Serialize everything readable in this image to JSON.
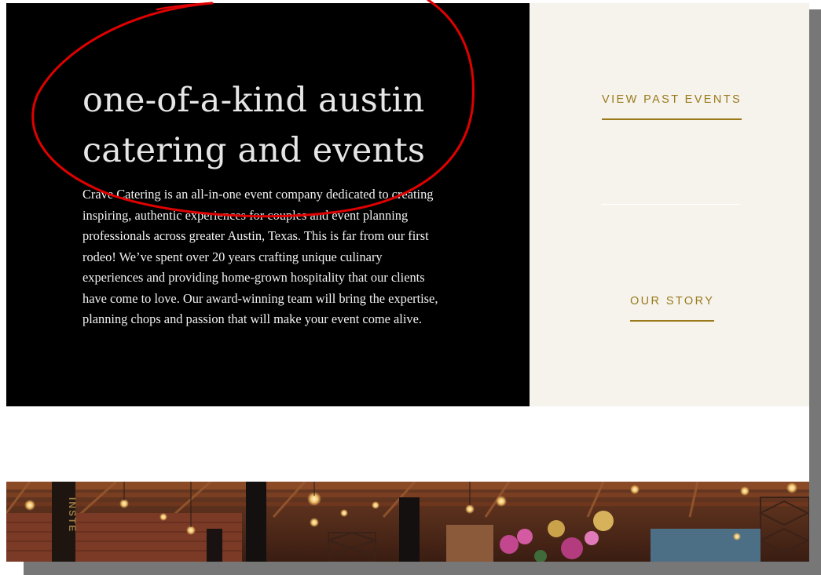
{
  "hero": {
    "title_line1": "one-of-a-kind austin",
    "title_line2": "catering and events",
    "body": "Crave Catering is an all-in-one event company dedicated to creating inspiring, authentic experiences for couples and event planning professionals across greater Austin, Texas. This is far from our first rodeo! We’ve spent over 20 years crafting unique culinary experiences and providing home-grown hospitality that our clients have come to love. Our award-winning team will bring the expertise, planning chops and passion that will make your event come alive."
  },
  "side": {
    "view_past_events": "VIEW PAST EVENTS",
    "our_story": "OUR STORY"
  },
  "colors": {
    "hero_bg": "#000000",
    "side_bg": "#f5f3ec",
    "accent_gold": "#9b7a1c",
    "annotation_red": "#e00000"
  },
  "photo": {
    "vertical_sign_text": "INSTE"
  }
}
